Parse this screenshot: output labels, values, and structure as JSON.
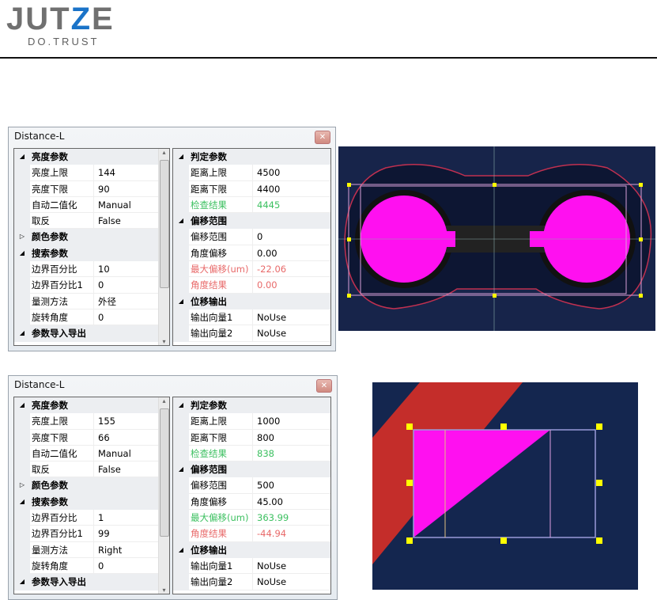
{
  "logo": {
    "brand_a": "JUT",
    "brand_z": "Z",
    "brand_b": "E",
    "tagline": "DO.TRUST"
  },
  "panels": [
    {
      "title": "Distance-L",
      "left": [
        {
          "type": "cat",
          "expanded": true,
          "label": "亮度参数"
        },
        {
          "label": "亮度上限",
          "value": "144"
        },
        {
          "label": "亮度下限",
          "value": "90"
        },
        {
          "label": "自动二值化",
          "value": "Manual"
        },
        {
          "label": "取反",
          "value": "False"
        },
        {
          "type": "cat",
          "expanded": false,
          "label": "颜色参数"
        },
        {
          "type": "cat",
          "expanded": true,
          "label": "搜索参数"
        },
        {
          "label": "边界百分比",
          "value": "10"
        },
        {
          "label": "边界百分比1",
          "value": "0"
        },
        {
          "label": "量测方法",
          "value": "外径"
        },
        {
          "label": "旋转角度",
          "value": "0"
        },
        {
          "type": "cat",
          "expanded": true,
          "label": "参数导入导出"
        }
      ],
      "right": [
        {
          "type": "cat",
          "expanded": true,
          "label": "判定参数"
        },
        {
          "label": "距离上限",
          "value": "4500"
        },
        {
          "label": "距离下限",
          "value": "4400"
        },
        {
          "label": "检查结果",
          "value": "4445",
          "status": "green"
        },
        {
          "type": "cat",
          "expanded": true,
          "label": "偏移范围"
        },
        {
          "label": "偏移范围",
          "value": "0"
        },
        {
          "label": "角度偏移",
          "value": "0.00"
        },
        {
          "label": "最大偏移(um)",
          "value": "-22.06",
          "status": "red"
        },
        {
          "label": "角度结果",
          "value": "0.00",
          "status": "red"
        },
        {
          "type": "cat",
          "expanded": true,
          "label": "位移输出"
        },
        {
          "label": "输出向量1",
          "value": "NoUse"
        },
        {
          "label": "输出向量2",
          "value": "NoUse"
        }
      ]
    },
    {
      "title": "Distance-L",
      "left": [
        {
          "type": "cat",
          "expanded": true,
          "label": "亮度参数"
        },
        {
          "label": "亮度上限",
          "value": "155"
        },
        {
          "label": "亮度下限",
          "value": "66"
        },
        {
          "label": "自动二值化",
          "value": "Manual"
        },
        {
          "label": "取反",
          "value": "False"
        },
        {
          "type": "cat",
          "expanded": false,
          "label": "颜色参数"
        },
        {
          "type": "cat",
          "expanded": true,
          "label": "搜索参数"
        },
        {
          "label": "边界百分比",
          "value": "1"
        },
        {
          "label": "边界百分比1",
          "value": "99"
        },
        {
          "label": "量测方法",
          "value": "Right"
        },
        {
          "label": "旋转角度",
          "value": "0"
        },
        {
          "type": "cat",
          "expanded": true,
          "label": "参数导入导出"
        }
      ],
      "right": [
        {
          "type": "cat",
          "expanded": true,
          "label": "判定参数"
        },
        {
          "label": "距离上限",
          "value": "1000"
        },
        {
          "label": "距离下限",
          "value": "800"
        },
        {
          "label": "检查结果",
          "value": "838",
          "status": "green"
        },
        {
          "type": "cat",
          "expanded": true,
          "label": "偏移范围"
        },
        {
          "label": "偏移范围",
          "value": "500"
        },
        {
          "label": "角度偏移",
          "value": "45.00"
        },
        {
          "label": "最大偏移(um)",
          "value": "363.99",
          "status": "green"
        },
        {
          "label": "角度结果",
          "value": "-44.94",
          "status": "red"
        },
        {
          "type": "cat",
          "expanded": true,
          "label": "位移输出"
        },
        {
          "label": "输出向量1",
          "value": "NoUse"
        },
        {
          "label": "输出向量2",
          "value": "NoUse"
        }
      ]
    }
  ]
}
